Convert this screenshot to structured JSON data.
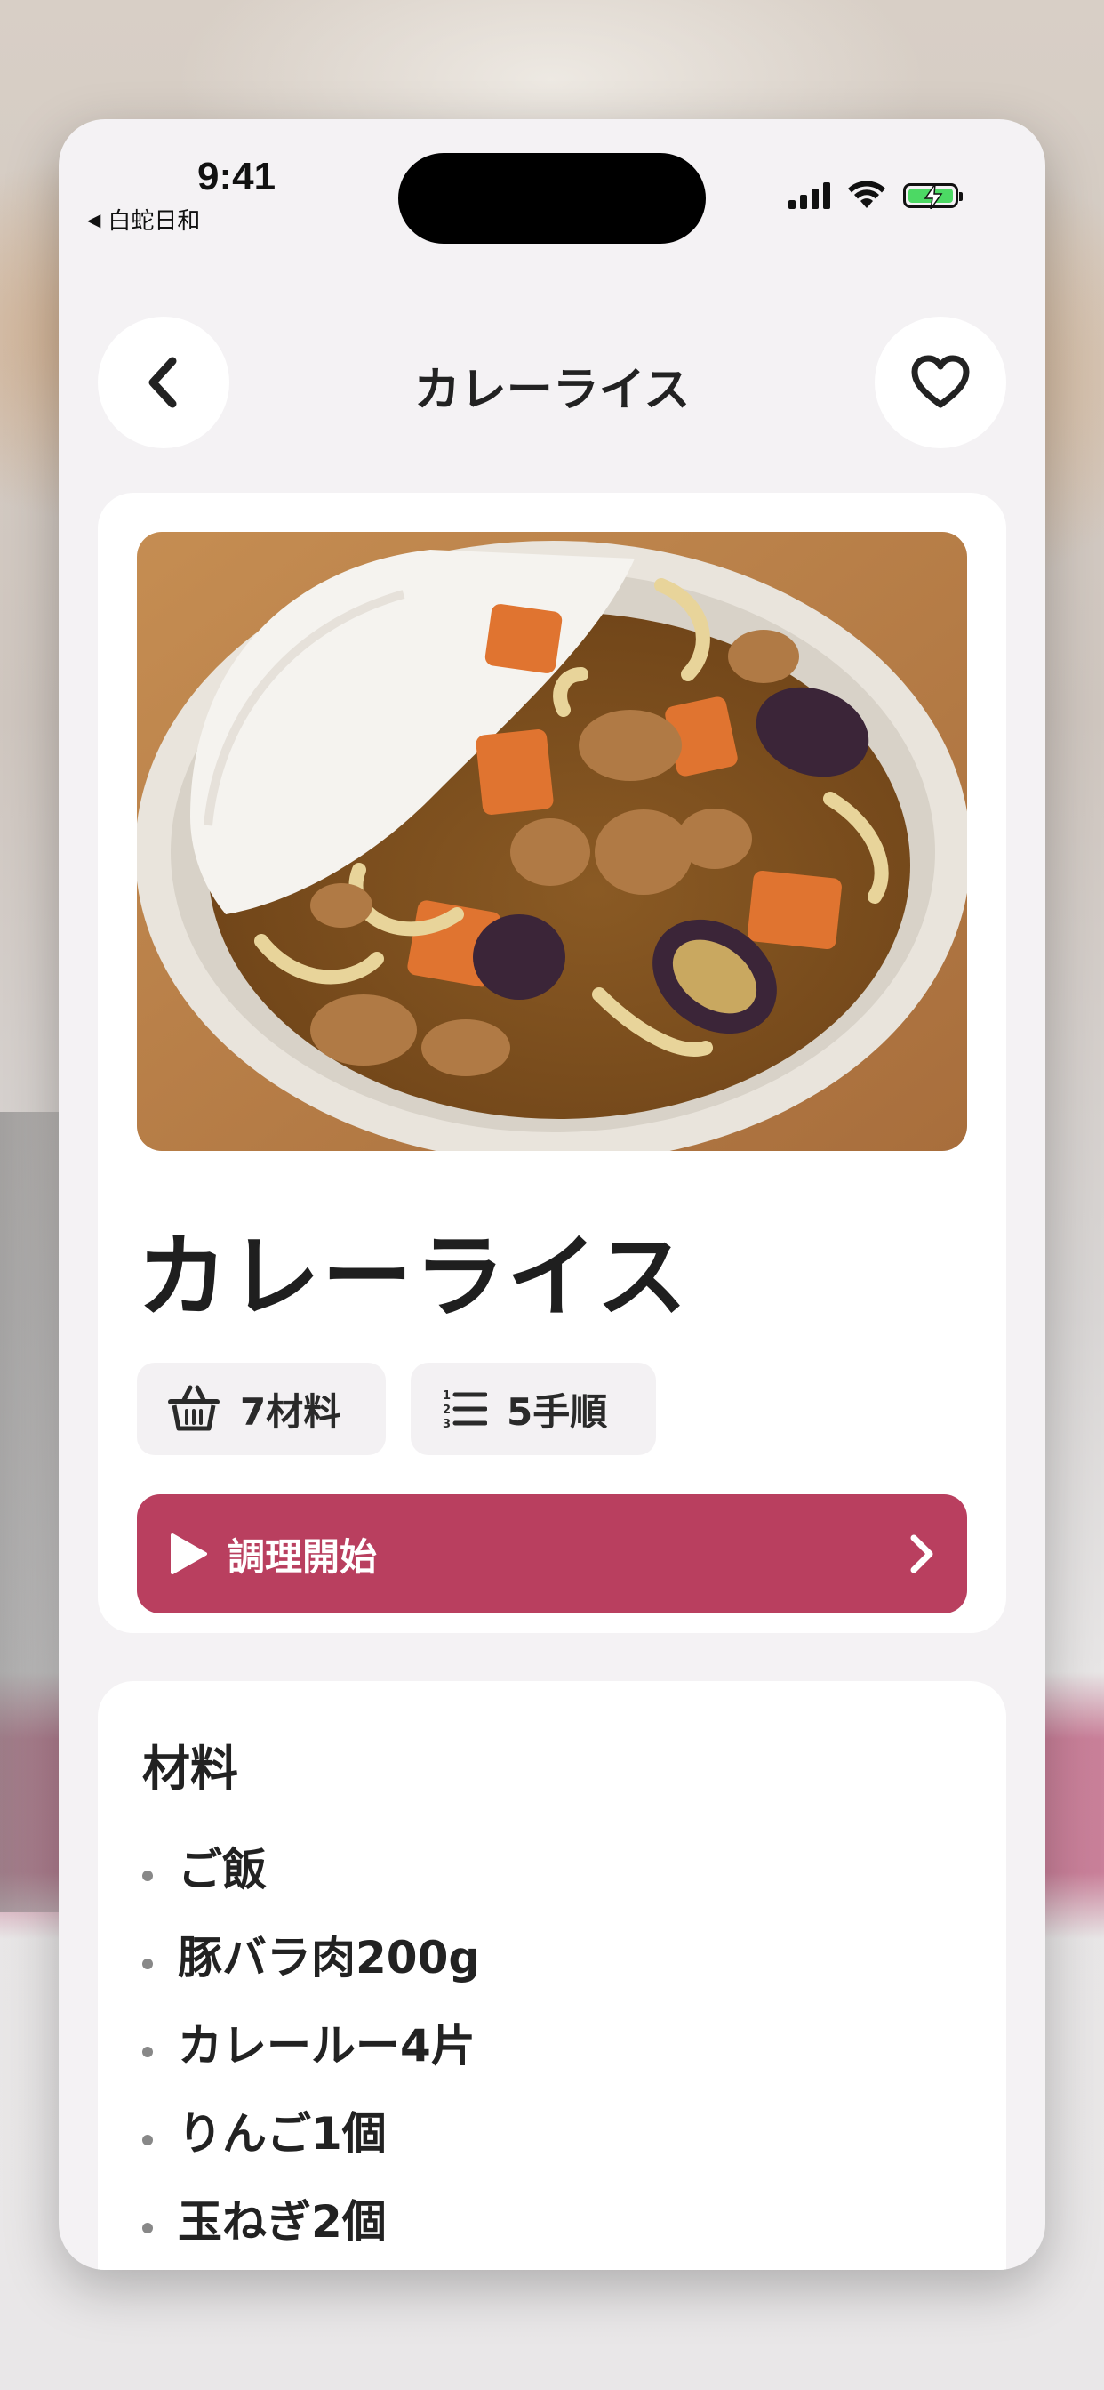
{
  "status_bar": {
    "time": "9:41",
    "back_app": "白蛇日和",
    "battery_color": "#4cd964"
  },
  "nav": {
    "title": "カレーライス",
    "back_icon": "chevron-left-icon",
    "favorite_icon": "heart-icon"
  },
  "recipe": {
    "title": "カレーライス",
    "image_alt": "カレーライス",
    "ingredients_count_label": "7材料",
    "steps_count_label": "5手順",
    "start_button_label": "調理開始",
    "accent_color": "#b93f5f"
  },
  "ingredients": {
    "heading": "材料",
    "items": [
      "ご飯",
      "豚バラ肉200g",
      "カレールー4片",
      "りんご1個",
      "玉ねぎ2個"
    ]
  }
}
